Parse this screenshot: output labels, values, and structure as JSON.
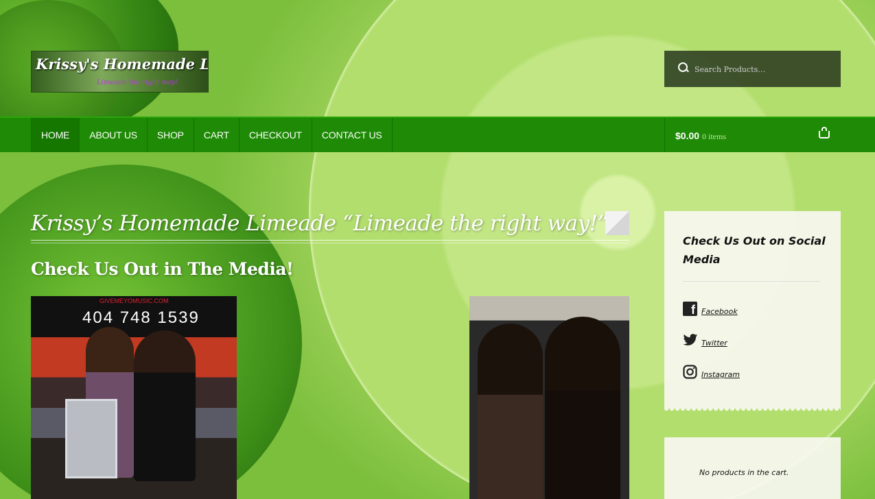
{
  "header": {
    "logo_title": "Krissy's Homemade Limeade",
    "logo_tagline": "Limeade the right way!",
    "search_placeholder": "Search Products…"
  },
  "nav": {
    "items": [
      {
        "label": "HOME",
        "active": true
      },
      {
        "label": "ABOUT US"
      },
      {
        "label": "SHOP"
      },
      {
        "label": "CART"
      },
      {
        "label": "CHECKOUT"
      },
      {
        "label": "CONTACT US"
      }
    ],
    "cart_amount": "$0.00",
    "cart_count": "0 items"
  },
  "main": {
    "page_title": "Krissy’s Homemade Limeade “Limeade the right way!”",
    "section_heading": "Check Us Out in The Media!",
    "photo1": {
      "phone": "404 748 1539",
      "site": "GIVEMEYOMUSIC.COM"
    }
  },
  "sidebar": {
    "social_title": "Check Us Out on Social Media",
    "links": [
      {
        "label": "Facebook",
        "icon": "facebook-icon"
      },
      {
        "label": "Twitter",
        "icon": "twitter-icon"
      },
      {
        "label": "Instagram",
        "icon": "instagram-icon"
      }
    ],
    "cart_empty": "No products in the cart."
  },
  "colors": {
    "nav_green": "#1e8a05",
    "nav_active": "#157600",
    "search_bg": "#28371e"
  }
}
